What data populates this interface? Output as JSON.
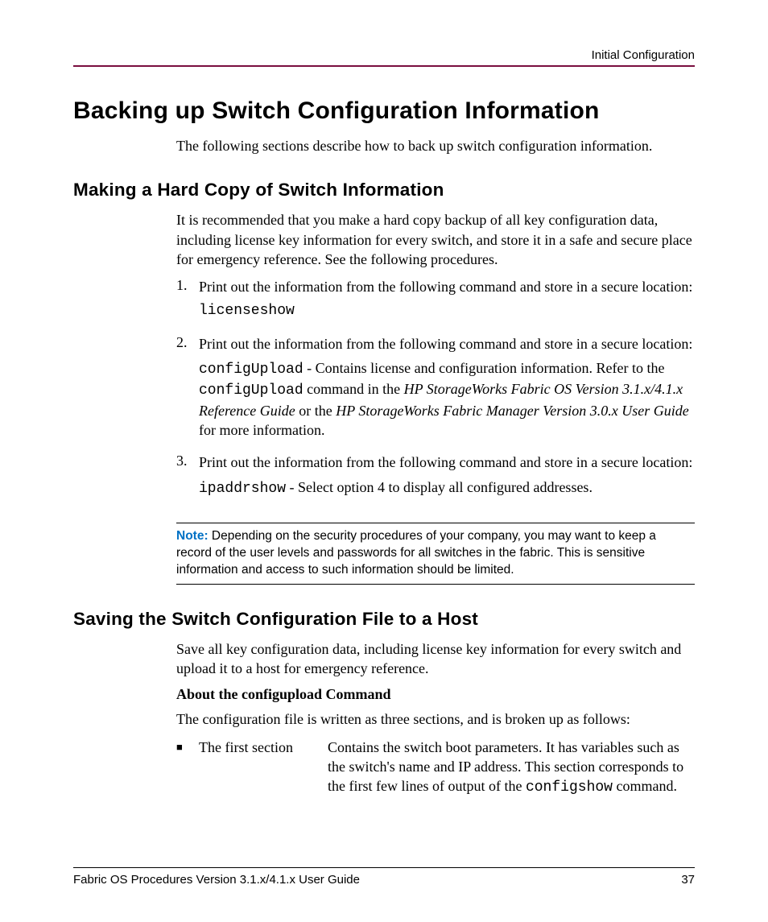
{
  "header": {
    "right": "Initial Configuration"
  },
  "h1": "Backing up Switch Configuration Information",
  "intro": "The following sections describe how to back up switch configuration information.",
  "sec1": {
    "title": "Making a Hard Copy of Switch Information",
    "p1": "It is recommended that you make a hard copy backup of all key configuration data, including license key information for every switch, and store it in a safe and secure place for emergency reference. See the following procedures.",
    "items": {
      "n1": "1.",
      "n2": "2.",
      "n3": "3.",
      "t1": "Print out the information from the following command and store in a secure location:",
      "c1": "licenseshow",
      "t2": "Print out the information from the following command and store in a secure location:",
      "c2a": "configUpload",
      "t2b": " - Contains license and configuration information. Refer to the ",
      "c2b": "configUpload",
      "t2c": " command in the ",
      "ref1": "HP StorageWorks Fabric OS Version 3.1.x/4.1.x Reference Guide",
      "t2d": " or the ",
      "ref2": "HP StorageWorks Fabric Manager Version 3.0.x User Guide",
      "t2e": " for more information.",
      "t3": "Print out the information from the following command and store in a secure location:",
      "c3": "ipaddrshow",
      "t3b": " - Select option 4 to display all configured addresses."
    },
    "note": {
      "label": "Note:",
      "text": "  Depending on the security procedures of your company, you may want to keep a record of the user levels and passwords for all switches in the fabric. This is sensitive information and access to such information should be limited."
    }
  },
  "sec2": {
    "title": "Saving the Switch Configuration File to a Host",
    "p1": "Save all key configuration data, including license key information for every switch and upload it to a host for emergency reference.",
    "sub": "About the configupload Command",
    "p2": "The configuration file is written as three sections, and is broken up as follows:",
    "bullet": {
      "mark": "■",
      "term": "The first section",
      "def1": "Contains the switch boot parameters. It has variables such as the switch's name and IP address. This section corresponds to the first few lines of output of the ",
      "cmd": "configshow",
      "def2": " command."
    }
  },
  "footer": {
    "left": "Fabric OS Procedures Version 3.1.x/4.1.x User Guide",
    "right": "37"
  }
}
